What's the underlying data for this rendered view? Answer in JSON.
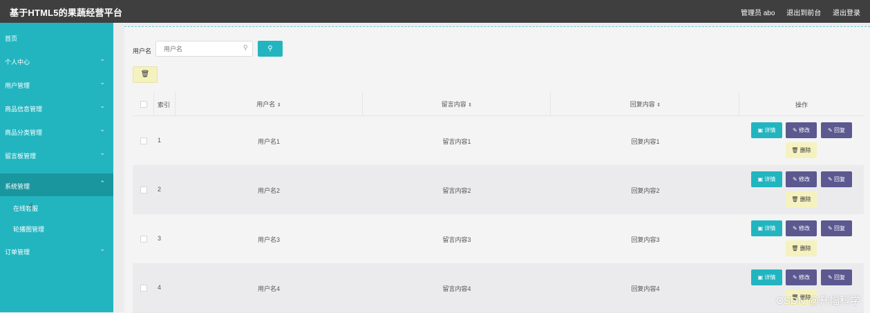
{
  "header": {
    "title": "基于HTML5的果蔬经营平台",
    "admin_label": "管理员 abo",
    "back_front": "退出到前台",
    "logout": "退出登录"
  },
  "sidebar": {
    "items": [
      {
        "label": "首页",
        "has_chevron": false
      },
      {
        "label": "个人中心",
        "has_chevron": true
      },
      {
        "label": "用户管理",
        "has_chevron": true
      },
      {
        "label": "商品信息管理",
        "has_chevron": true
      },
      {
        "label": "商品分类管理",
        "has_chevron": true
      },
      {
        "label": "留言板管理",
        "has_chevron": true
      },
      {
        "label": "系统管理",
        "has_chevron": true,
        "expanded": true
      },
      {
        "label": "订单管理",
        "has_chevron": true
      }
    ],
    "sub_items": [
      "在线客服",
      "轮播图管理"
    ]
  },
  "search": {
    "label": "用户名",
    "placeholder": "用户名",
    "button_icon": "search-icon"
  },
  "toolbar": {
    "delete_icon": "trash-icon"
  },
  "table": {
    "headers": {
      "index": "索引",
      "username": "用户名",
      "message": "留言内容",
      "reply": "回复内容",
      "actions": "操作"
    },
    "rows": [
      {
        "index": "1",
        "username": "用户名1",
        "message": "留言内容1",
        "reply": "回复内容1"
      },
      {
        "index": "2",
        "username": "用户名2",
        "message": "留言内容2",
        "reply": "回复内容2"
      },
      {
        "index": "3",
        "username": "用户名3",
        "message": "留言内容3",
        "reply": "回复内容3"
      },
      {
        "index": "4",
        "username": "用户名4",
        "message": "留言内容4",
        "reply": "回复内容4"
      }
    ],
    "action_labels": {
      "detail": "详情",
      "edit": "修改",
      "reply": "回复",
      "delete": "删除"
    }
  },
  "watermark": "CSDN @升幅科学",
  "colors": {
    "topbar": "#3f3f3f",
    "sidebar": "#22b5c0",
    "sidebar_active": "#1a969f",
    "primary_button": "#22b5c0",
    "secondary_button": "#5c5890",
    "delete_button": "#f5f2c0"
  }
}
